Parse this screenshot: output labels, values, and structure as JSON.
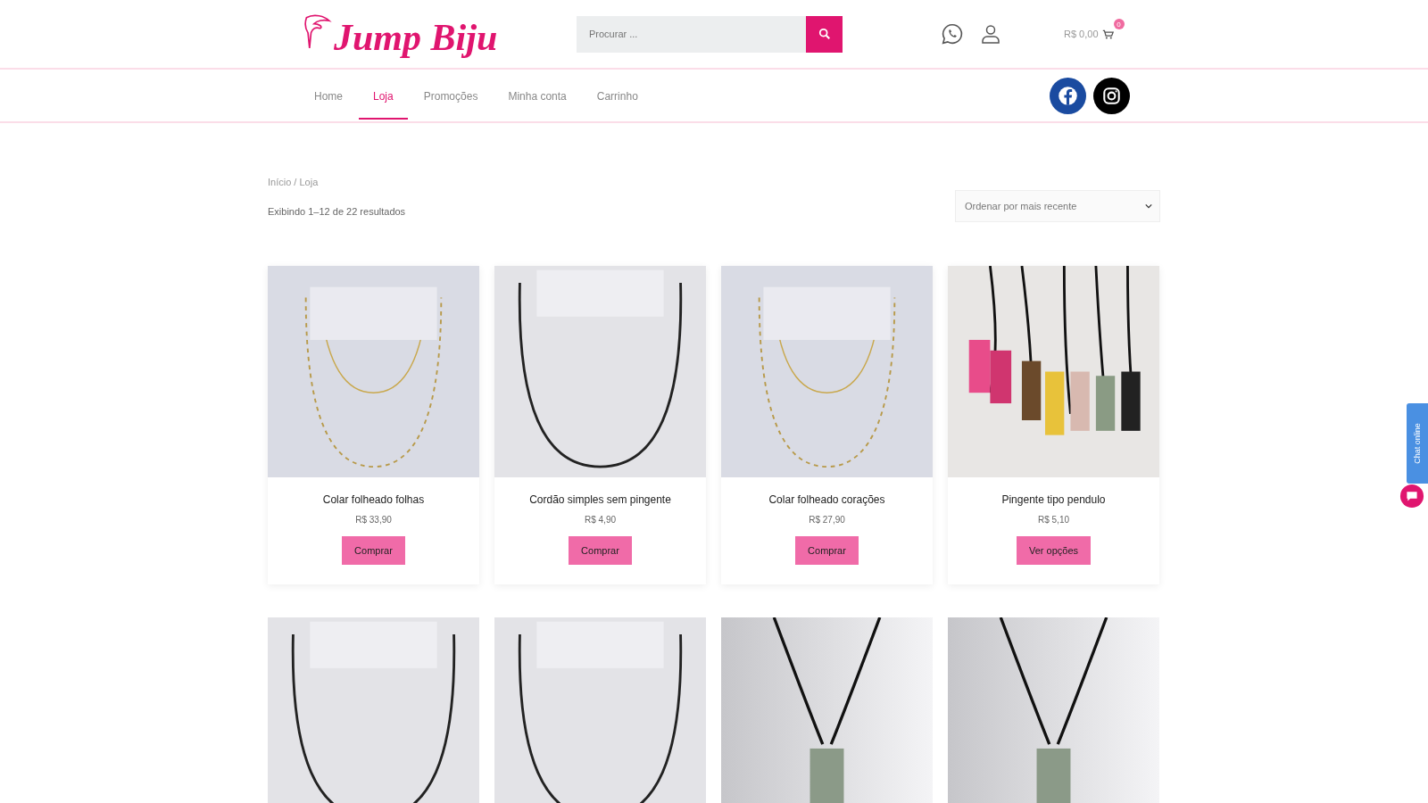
{
  "header": {
    "logo": "Jump Biju",
    "search": {
      "placeholder": "Procurar ..."
    },
    "cart": {
      "total": "R$ 0,00",
      "count": "0"
    }
  },
  "nav": {
    "items": [
      {
        "label": "Home",
        "selected": false
      },
      {
        "label": "Loja",
        "selected": true
      },
      {
        "label": "Promoções",
        "selected": false
      },
      {
        "label": "Minha conta",
        "selected": false
      },
      {
        "label": "Carrinho",
        "selected": false
      }
    ]
  },
  "breadcrumb": "Início / Loja",
  "result_count": "Exibindo 1–12 de 22 resultados",
  "sort": {
    "value": "Ordenar por mais recente"
  },
  "products": [
    {
      "name": "Colar folheado folhas",
      "price": "R$ 33,90",
      "button": "Comprar",
      "kind": "chain"
    },
    {
      "name": "Cordão simples sem pingente",
      "price": "R$ 4,90",
      "button": "Comprar",
      "kind": "cord"
    },
    {
      "name": "Colar folheado corações",
      "price": "R$ 27,90",
      "button": "Comprar",
      "kind": "chain"
    },
    {
      "name": "Pingente tipo pendulo",
      "price": "R$ 5,10",
      "button": "Ver opções",
      "kind": "crystals"
    },
    {
      "kind": "cord"
    },
    {
      "kind": "cord"
    },
    {
      "kind": "pendant"
    },
    {
      "kind": "pendant"
    }
  ],
  "chat_tab": "Chat online"
}
